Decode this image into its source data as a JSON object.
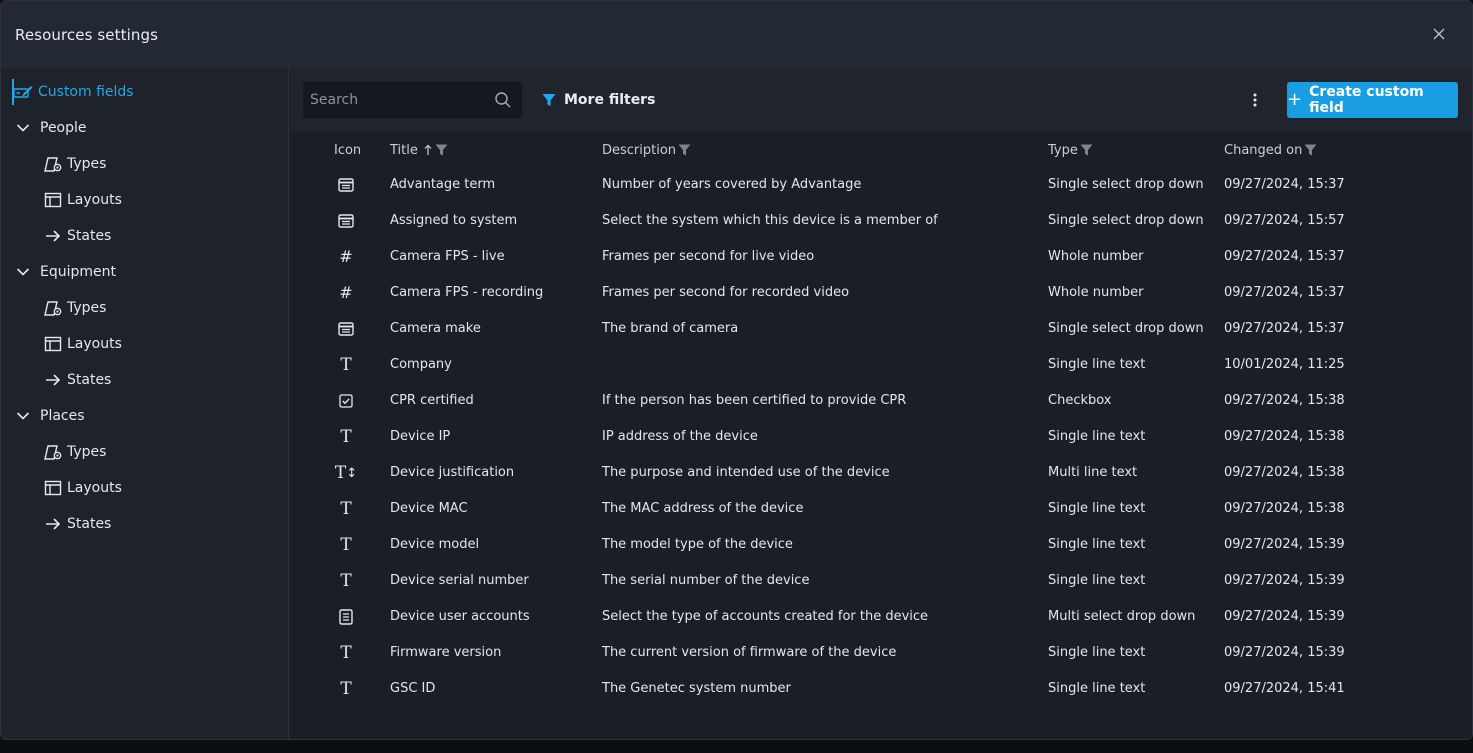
{
  "window": {
    "title": "Resources settings"
  },
  "sidebar": {
    "custom_fields": "Custom fields",
    "groups": [
      {
        "label": "People",
        "children": [
          "Types",
          "Layouts",
          "States"
        ]
      },
      {
        "label": "Equipment",
        "children": [
          "Types",
          "Layouts",
          "States"
        ]
      },
      {
        "label": "Places",
        "children": [
          "Types",
          "Layouts",
          "States"
        ]
      }
    ]
  },
  "toolbar": {
    "search_placeholder": "Search",
    "more_filters": "More filters",
    "create_label": "Create custom field"
  },
  "colors": {
    "accent": "#1a9ee3",
    "active_text": "#23a7ea"
  },
  "table": {
    "headers": {
      "icon": "Icon",
      "title": "Title",
      "description": "Description",
      "type": "Type",
      "changed_on": "Changed on"
    },
    "rows": [
      {
        "icon": "dropdown-icon",
        "title": "Advantage term",
        "description": "Number of years covered by Advantage",
        "type": "Single select drop down",
        "changed_on": "09/27/2024, 15:37"
      },
      {
        "icon": "dropdown-icon",
        "title": "Assigned to system",
        "description": "Select the system which this device is a member of",
        "type": "Single select drop down",
        "changed_on": "09/27/2024, 15:57"
      },
      {
        "icon": "hash-icon",
        "title": "Camera FPS - live",
        "description": "Frames per second for live video",
        "type": "Whole number",
        "changed_on": "09/27/2024, 15:37"
      },
      {
        "icon": "hash-icon",
        "title": "Camera FPS - recording",
        "description": "Frames per second for recorded video",
        "type": "Whole number",
        "changed_on": "09/27/2024, 15:37"
      },
      {
        "icon": "dropdown-icon",
        "title": "Camera make",
        "description": "The brand of camera",
        "type": "Single select drop down",
        "changed_on": "09/27/2024, 15:37"
      },
      {
        "icon": "text-icon",
        "title": "Company",
        "description": "",
        "type": "Single line text",
        "changed_on": "10/01/2024, 11:25"
      },
      {
        "icon": "checkbox-icon",
        "title": "CPR certified",
        "description": "If the person has been certified to provide CPR",
        "type": "Checkbox",
        "changed_on": "09/27/2024, 15:38"
      },
      {
        "icon": "text-icon",
        "title": "Device IP",
        "description": "IP address of the device",
        "type": "Single line text",
        "changed_on": "09/27/2024, 15:38"
      },
      {
        "icon": "multiline-text-icon",
        "title": "Device justification",
        "description": "The purpose and intended use of the device",
        "type": "Multi line text",
        "changed_on": "09/27/2024, 15:38"
      },
      {
        "icon": "text-icon",
        "title": "Device MAC",
        "description": "The MAC address of the device",
        "type": "Single line text",
        "changed_on": "09/27/2024, 15:38"
      },
      {
        "icon": "text-icon",
        "title": "Device model",
        "description": "The model type of the device",
        "type": "Single line text",
        "changed_on": "09/27/2024, 15:39"
      },
      {
        "icon": "text-icon",
        "title": "Device serial number",
        "description": "The serial number of the device",
        "type": "Single line text",
        "changed_on": "09/27/2024, 15:39"
      },
      {
        "icon": "multi-select-icon",
        "title": "Device user accounts",
        "description": "Select the type of accounts created for the device",
        "type": "Multi select drop down",
        "changed_on": "09/27/2024, 15:39"
      },
      {
        "icon": "text-icon",
        "title": "Firmware version",
        "description": "The current version of firmware of the device",
        "type": "Single line text",
        "changed_on": "09/27/2024, 15:39"
      },
      {
        "icon": "text-icon",
        "title": "GSC ID",
        "description": "The Genetec system number",
        "type": "Single line text",
        "changed_on": "09/27/2024, 15:41"
      }
    ]
  }
}
